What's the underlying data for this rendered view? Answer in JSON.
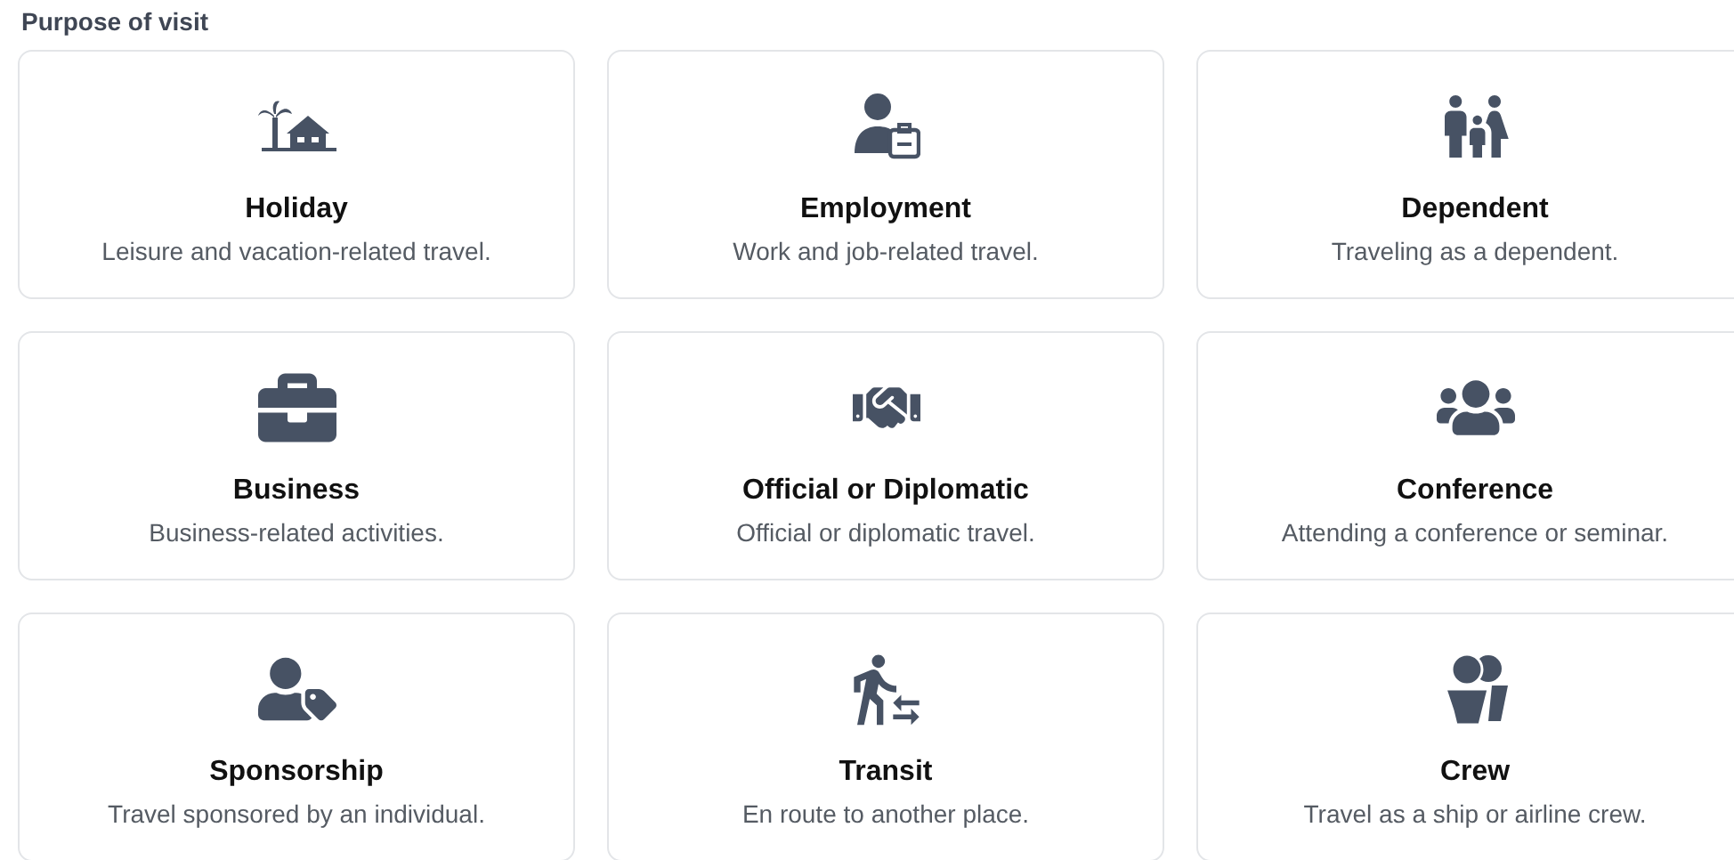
{
  "heading": "Purpose of visit",
  "options": [
    {
      "title": "Holiday",
      "description": "Leisure and vacation-related travel."
    },
    {
      "title": "Employment",
      "description": "Work and job-related travel."
    },
    {
      "title": "Dependent",
      "description": "Traveling as a dependent."
    },
    {
      "title": "Business",
      "description": "Business-related activities."
    },
    {
      "title": "Official or Diplomatic",
      "description": "Official or diplomatic travel."
    },
    {
      "title": "Conference",
      "description": "Attending a conference or seminar."
    },
    {
      "title": "Sponsorship",
      "description": "Travel sponsored by an individual."
    },
    {
      "title": "Transit",
      "description": "En route to another place."
    },
    {
      "title": "Crew",
      "description": "Travel as a ship or airline crew."
    }
  ]
}
